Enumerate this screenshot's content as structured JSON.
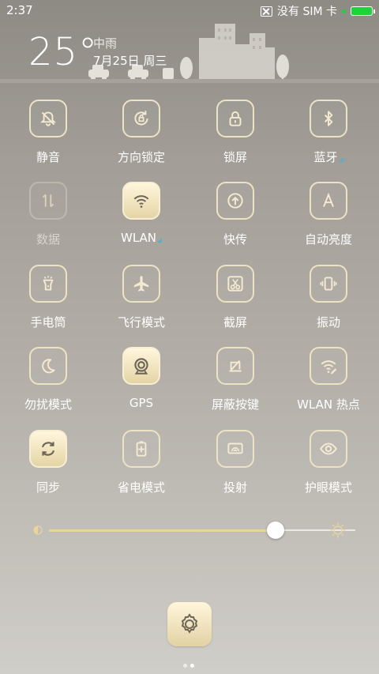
{
  "status_bar": {
    "time": "2:37",
    "no_sim": "没有 SIM 卡"
  },
  "weather": {
    "temperature": "25°",
    "condition": "中雨",
    "date": "7月25日 周三"
  },
  "colors": {
    "accent_gold": "#e4d4a6",
    "tile_border": "#ece3c4",
    "battery": "#1dd33c",
    "indicator": "#4fb3c9"
  },
  "toggles": [
    {
      "label": "静音",
      "icon": "bell-off-icon",
      "state": "off"
    },
    {
      "label": "方向锁定",
      "icon": "rotation-lock-icon",
      "state": "off"
    },
    {
      "label": "锁屏",
      "icon": "lock-icon",
      "state": "off"
    },
    {
      "label": "蓝牙",
      "icon": "bluetooth-icon",
      "state": "off",
      "has_more": true
    },
    {
      "label": "数据",
      "icon": "data-arrows-icon",
      "state": "disabled"
    },
    {
      "label": "WLAN",
      "icon": "wifi-icon",
      "state": "on",
      "has_more": true
    },
    {
      "label": "快传",
      "icon": "upload-icon",
      "state": "off"
    },
    {
      "label": "自动亮度",
      "icon": "auto-brightness-icon",
      "state": "off"
    },
    {
      "label": "手电筒",
      "icon": "flashlight-icon",
      "state": "off"
    },
    {
      "label": "飞行模式",
      "icon": "airplane-icon",
      "state": "off"
    },
    {
      "label": "截屏",
      "icon": "scissors-icon",
      "state": "off"
    },
    {
      "label": "振动",
      "icon": "vibrate-icon",
      "state": "off"
    },
    {
      "label": "勿扰模式",
      "icon": "moon-icon",
      "state": "off"
    },
    {
      "label": "GPS",
      "icon": "location-icon",
      "state": "on"
    },
    {
      "label": "屏蔽按键",
      "icon": "key-block-icon",
      "state": "off"
    },
    {
      "label": "WLAN 热点",
      "icon": "hotspot-icon",
      "state": "off"
    },
    {
      "label": "同步",
      "icon": "sync-icon",
      "state": "on"
    },
    {
      "label": "省电模式",
      "icon": "battery-saver-icon",
      "state": "off"
    },
    {
      "label": "投射",
      "icon": "cast-icon",
      "state": "off"
    },
    {
      "label": "护眼模式",
      "icon": "eye-icon",
      "state": "off"
    }
  ],
  "brightness": {
    "level_fraction": 0.74
  },
  "pager": {
    "pages": 2,
    "current": 2
  }
}
